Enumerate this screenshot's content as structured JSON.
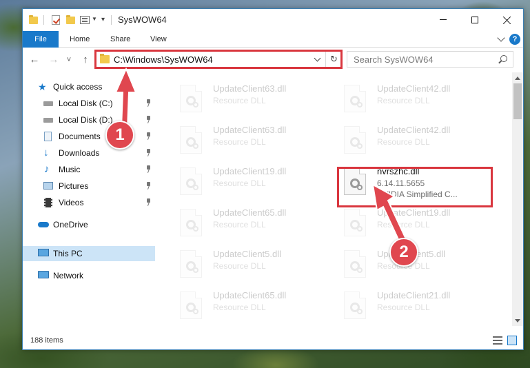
{
  "window": {
    "title": "SysWOW64",
    "controls": {
      "minimize": "—",
      "maximize": "☐",
      "close": "✕"
    }
  },
  "ribbon": {
    "tabs": [
      "File",
      "Home",
      "Share",
      "View"
    ],
    "help": "?"
  },
  "nav": {
    "back": "←",
    "forward": "→",
    "recent": "˅",
    "up": "↑",
    "address": "C:\\Windows\\SysWOW64",
    "refresh": "↻",
    "search_placeholder": "Search SysWOW64"
  },
  "sidebar": {
    "items": [
      {
        "label": "Quick access",
        "icon": "star-icon"
      },
      {
        "label": "Local Disk (C:)",
        "icon": "drive-icon",
        "pinned": true
      },
      {
        "label": "Local Disk (D:)",
        "icon": "drive-icon",
        "pinned": true
      },
      {
        "label": "Documents",
        "icon": "documents-icon",
        "pinned": true
      },
      {
        "label": "Downloads",
        "icon": "downloads-icon",
        "pinned": true
      },
      {
        "label": "Music",
        "icon": "music-icon",
        "pinned": true
      },
      {
        "label": "Pictures",
        "icon": "pictures-icon",
        "pinned": true
      },
      {
        "label": "Videos",
        "icon": "videos-icon",
        "pinned": true
      },
      {
        "label": "OneDrive",
        "icon": "cloud-icon"
      },
      {
        "label": "This PC",
        "icon": "computer-icon",
        "selected": true
      },
      {
        "label": "Network",
        "icon": "network-icon"
      }
    ]
  },
  "files": [
    {
      "name": "UpdateClient63.dll",
      "sub": "Resource DLL"
    },
    {
      "name": "UpdateClient42.dll",
      "sub": "Resource DLL"
    },
    {
      "name": "UpdateClient63.dll",
      "sub": "Resource DLL"
    },
    {
      "name": "UpdateClient42.dll",
      "sub": "Resource DLL"
    },
    {
      "name": "UpdateClient19.dll",
      "sub": "Resource DLL"
    },
    {
      "name": "nvrszhc.dll",
      "version": "6.14.11.5655",
      "description": "NVIDIA Simplified C...",
      "highlighted": true
    },
    {
      "name": "UpdateClient65.dll",
      "sub": "Resource DLL"
    },
    {
      "name": "UpdateClient19.dll",
      "sub": "Resource DLL"
    },
    {
      "name": "UpdateClient5.dll",
      "sub": "Resource DLL"
    },
    {
      "name": "UpdateClient5.dll",
      "sub": "Resource DLL"
    },
    {
      "name": "UpdateClient65.dll",
      "sub": "Resource DLL"
    },
    {
      "name": "UpdateClient21.dll",
      "sub": "Resource DLL"
    }
  ],
  "status": {
    "item_count": "188 items"
  },
  "annotations": {
    "step1": "1",
    "step2": "2",
    "color": "#d9363e"
  }
}
